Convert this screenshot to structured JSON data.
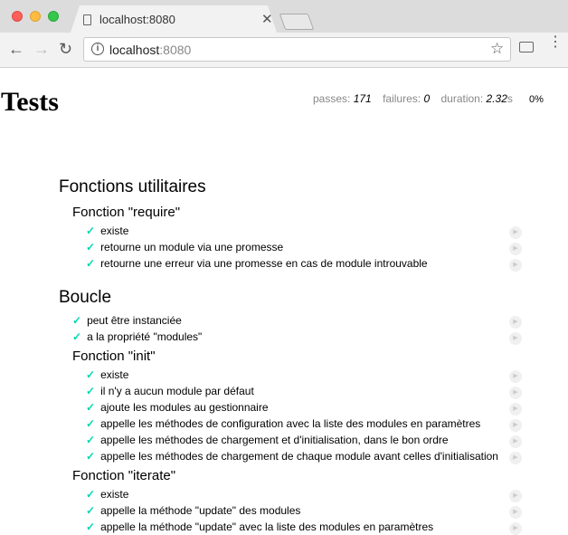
{
  "browser": {
    "tab_title": "localhost:8080",
    "tab_close": "✕",
    "url_host": "localhost",
    "url_port": ":8080",
    "back_icon": "←",
    "forward_icon": "→",
    "reload_icon": "↻",
    "star_icon": "☆",
    "info_icon": "i",
    "menu_icon": "⋮"
  },
  "report": {
    "title": "Tests",
    "stats": {
      "passes_label": "passes:",
      "passes_value": "171",
      "failures_label": "failures:",
      "failures_value": "0",
      "duration_label": "duration:",
      "duration_value": "2.32",
      "duration_unit": "s"
    },
    "progress": "0%"
  },
  "suites": [
    {
      "title": "Fonctions utilitaires",
      "subsuites": [
        {
          "title": "Fonction \"require\"",
          "tests": [
            "existe",
            "retourne un module via une promesse",
            "retourne une erreur via une promesse en cas de module introuvable"
          ]
        }
      ]
    },
    {
      "title": "Boucle",
      "tests": [
        "peut être instanciée",
        "a la propriété \"modules\""
      ],
      "subsuites": [
        {
          "title": "Fonction \"init\"",
          "tests": [
            "existe",
            "il n'y a aucun module par défaut",
            "ajoute les modules au gestionnaire",
            "appelle les méthodes de configuration avec la liste des modules en paramètres",
            "appelle les méthodes de chargement et d'initialisation, dans le bon ordre",
            "appelle les méthodes de chargement de chaque module avant celles d'initialisation"
          ]
        },
        {
          "title": "Fonction \"iterate\"",
          "tests": [
            "existe",
            "appelle la méthode \"update\" des modules",
            "appelle la méthode \"update\" avec la liste des modules en paramètres"
          ]
        }
      ]
    }
  ],
  "check_icon": "✓",
  "replay_icon": "▶"
}
